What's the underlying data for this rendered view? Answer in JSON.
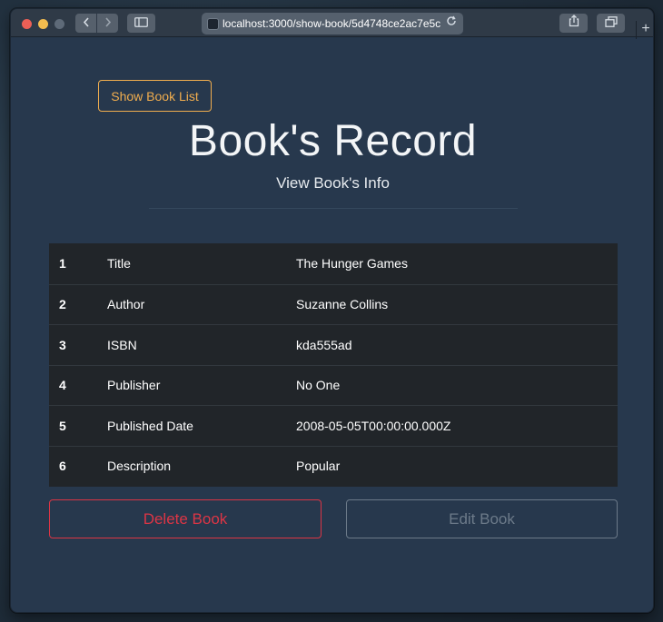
{
  "browser": {
    "address_url": "localhost:3000/show-book/5d4748ce2ac7e5c",
    "reload_icon": "reload-icon",
    "colors": {
      "window_bg": "#27384d",
      "titlebar_bg": "#2f3a47"
    }
  },
  "page": {
    "show_list_label": "Show Book List",
    "title": "Book's Record",
    "subtitle": "View Book's Info",
    "rows": [
      {
        "num": "1",
        "label": "Title",
        "value": "The Hunger Games"
      },
      {
        "num": "2",
        "label": "Author",
        "value": "Suzanne Collins"
      },
      {
        "num": "3",
        "label": "ISBN",
        "value": "kda555ad"
      },
      {
        "num": "4",
        "label": "Publisher",
        "value": "No One"
      },
      {
        "num": "5",
        "label": "Published Date",
        "value": "2008-05-05T00:00:00.000Z"
      },
      {
        "num": "6",
        "label": "Description",
        "value": "Popular"
      }
    ],
    "delete_label": "Delete Book",
    "edit_label": "Edit Book",
    "colors": {
      "warning": "#f0ad4e",
      "danger": "#dc3545",
      "muted": "#6c7a89",
      "table_bg": "#212529"
    }
  }
}
